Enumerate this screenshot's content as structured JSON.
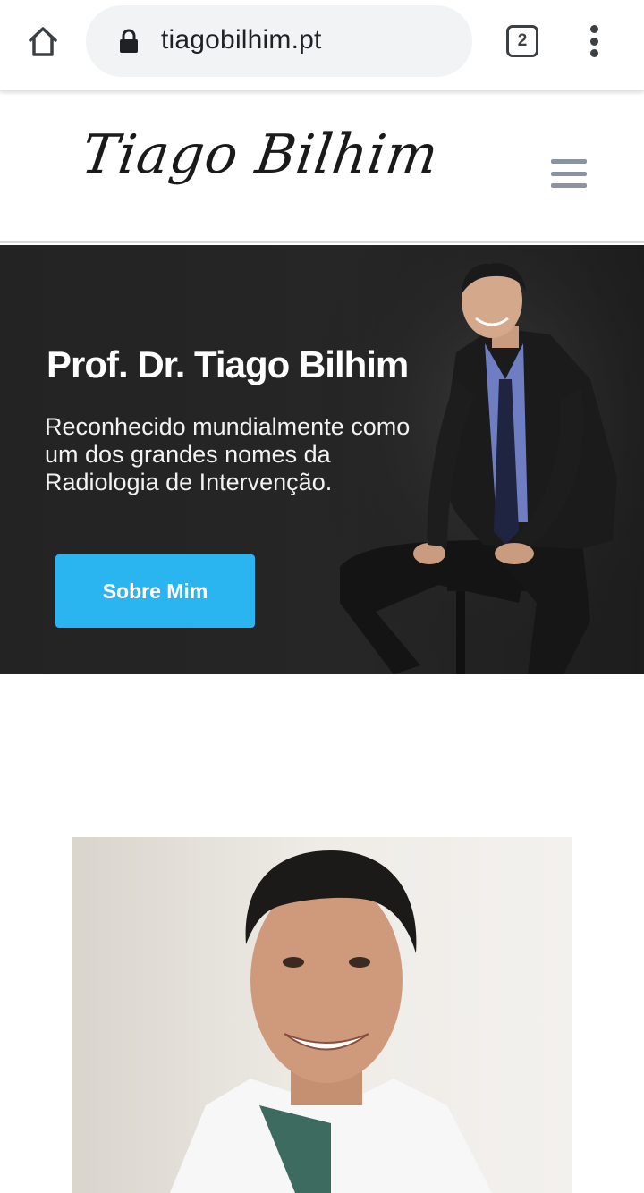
{
  "browser": {
    "url": "tiagobilhim.pt",
    "tab_count": "2",
    "icons": {
      "home": "home-icon",
      "lock": "lock-icon",
      "menu": "more-vert-icon"
    }
  },
  "header": {
    "logo_text": "Tiago Bilhim",
    "menu_icon": "hamburger-icon"
  },
  "hero": {
    "title": "Prof. Dr. Tiago Bilhim",
    "subtitle": "Reconhecido mundialmente como um dos grandes nomes da Radiologia de Intervenção.",
    "button_label": "Sobre Mim"
  },
  "colors": {
    "accent": "#2bb5f0",
    "hero_bg": "#232323",
    "hamburger": "#8c93a0"
  }
}
